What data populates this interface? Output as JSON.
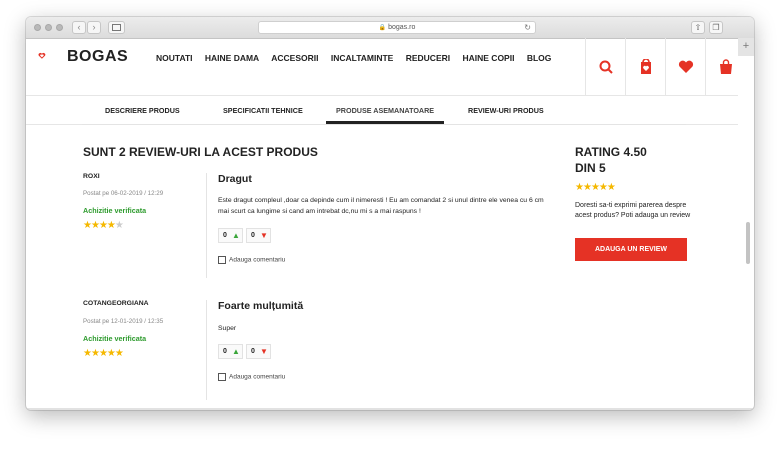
{
  "browser": {
    "url": "bogas.ro",
    "reload_icon": "↻",
    "back_icon": "‹",
    "forward_icon": "›",
    "share_icon": "⇧",
    "tabs_icon": "❐",
    "new_tab_icon": "+"
  },
  "site": {
    "logo": "BOGAS",
    "brand_color": "#e53225",
    "menu": [
      "NOUTATI",
      "HAINE DAMA",
      "ACCESORII",
      "INCALTAMINTE",
      "REDUCERI",
      "HAINE COPII",
      "BLOG"
    ],
    "header_icons": [
      "search-icon",
      "account-icon",
      "heart-icon",
      "bag-icon"
    ]
  },
  "tabs": {
    "items": [
      "DESCRIERE PRODUS",
      "SPECIFICATII TEHNICE",
      "PRODUSE ASEMANATOARE",
      "REVIEW-URI PRODUS"
    ],
    "active": "PRODUSE ASEMANATOARE"
  },
  "reviews": {
    "title": "SUNT 2 REVIEW-URI LA ACEST PRODUS",
    "list": [
      {
        "author": "ROXI",
        "posted": "Postat pe 06-02-2019 / 12:29",
        "verified": "Achizitie verificata",
        "rating": 4,
        "title": "Dragut",
        "text": "Este dragut compleul ,doar ca depinde cum il nimeresti ! Eu am comandat 2 si unul dintre ele venea cu 6 cm mai scurt ca lungime si cand am intrebat dc,nu mi s a mai raspuns !",
        "likes": "0",
        "dislikes": "0",
        "comment_label": "Adauga comentariu"
      },
      {
        "author": "COTANGEORGIANA",
        "posted": "Postat pe 12-01-2019 / 12:35",
        "verified": "Achizitie verificata",
        "rating": 5,
        "title": "Foarte mulțumită",
        "text": "Super",
        "likes": "0",
        "dislikes": "0",
        "comment_label": "Adauga comentariu"
      }
    ]
  },
  "summary": {
    "rating_line1": "RATING 4.50",
    "rating_line2": "DIN 5",
    "rating_value": 4.5,
    "invite_text": "Doresti sa-ti exprimi parerea despre acest produs? Poti adauga un review",
    "add_button": "ADAUGA UN REVIEW"
  }
}
